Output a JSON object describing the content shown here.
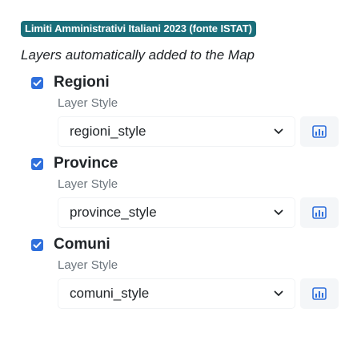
{
  "dataset": {
    "title": "Limiti Amministrativi Italiani 2023 (fonte ISTAT)",
    "accent_color": "#1a6e7a"
  },
  "subtitle": "Layers automatically added to the Map",
  "layers": [
    {
      "name": "Regioni",
      "checked": true,
      "style_label": "Layer Style",
      "style_value": "regioni_style",
      "legend_icon": "bar-chart-icon"
    },
    {
      "name": "Province",
      "checked": true,
      "style_label": "Layer Style",
      "style_value": "province_style",
      "legend_icon": "bar-chart-icon"
    },
    {
      "name": "Comuni",
      "checked": true,
      "style_label": "Layer Style",
      "style_value": "comuni_style",
      "legend_icon": "bar-chart-icon"
    }
  ],
  "colors": {
    "checkbox": "#2f6fdc",
    "legend_icon": "#2f6fdc",
    "muted_text": "#6c757d"
  }
}
